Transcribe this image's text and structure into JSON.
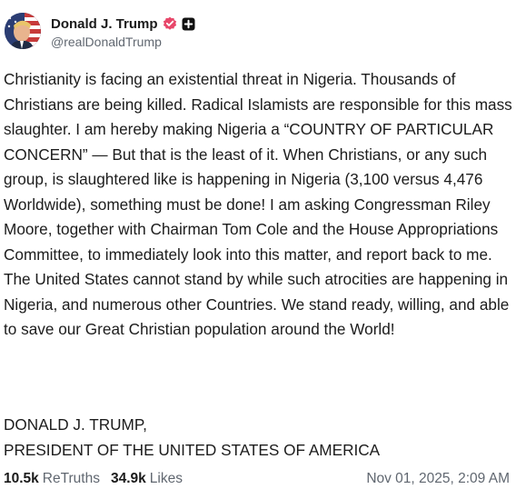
{
  "author": {
    "display_name": "Donald J. Trump",
    "handle": "@realDonaldTrump",
    "avatar_icon": "user-avatar",
    "verified_icon": "verified-badge-icon",
    "verified_color": "#e8476a",
    "plus_icon": "plus-badge-icon"
  },
  "post": {
    "body": "Christianity is facing an existential threat in Nigeria. Thousands of Christians are being killed. Radical Islamists are responsible for this mass slaughter. I am hereby making Nigeria a “COUNTRY OF PARTICULAR CONCERN” — But that is the least of it. When Christians, or any such group, is slaughtered like is happening in Nigeria (3,100 versus 4,476 Worldwide), something must be done! I am asking Congressman Riley Moore, together with Chairman Tom Cole and the House Appropriations Committee, to immediately look into this matter, and report back to me. The United States cannot stand by while such atrocities are happening in Nigeria, and numerous other Countries. We stand ready, willing, and able to save our Great Christian population around the World!",
    "signature": "DONALD J. TRUMP,\nPRESIDENT OF THE UNITED STATES OF AMERICA"
  },
  "stats": {
    "retruths_count": "10.5k",
    "retruths_label": "ReTruths",
    "likes_count": "34.9k",
    "likes_label": "Likes",
    "timestamp": "Nov 01, 2025, 2:09 AM"
  }
}
